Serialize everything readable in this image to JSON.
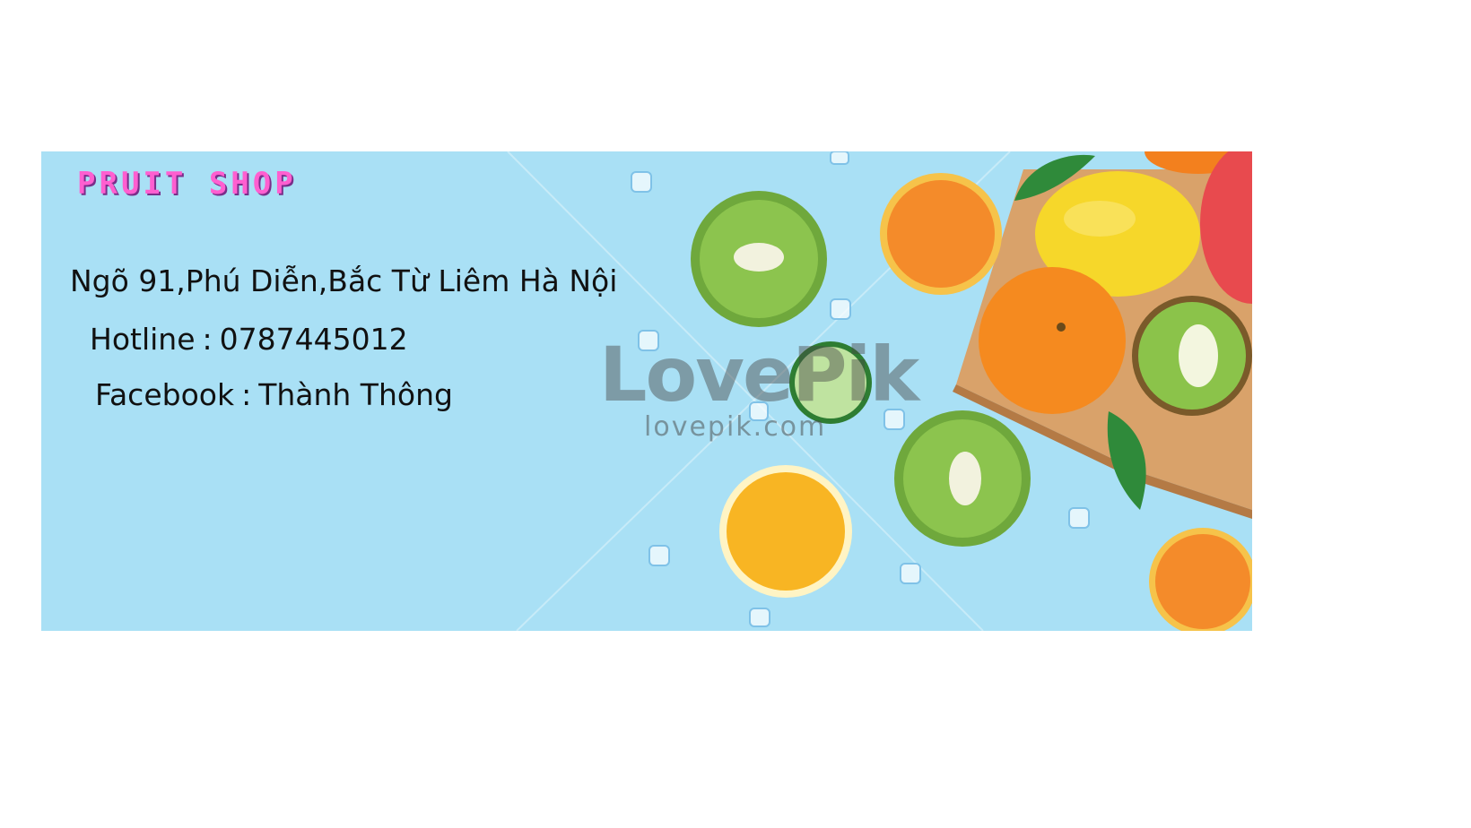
{
  "shop": {
    "name": "PRUIT SHOP",
    "address": "Ngõ 91,Phú Diễn,Bắc Từ Liêm Hà Nội",
    "hotline_label": "Hotline",
    "hotline_value": "0787445012",
    "facebook_label": "Facebook",
    "facebook_value": "Thành Thông"
  },
  "watermark": {
    "brand": "LovePik",
    "url": "lovepik.com"
  },
  "colors": {
    "banner_background": "#a9e0f5",
    "title": "#ff5fd0"
  }
}
